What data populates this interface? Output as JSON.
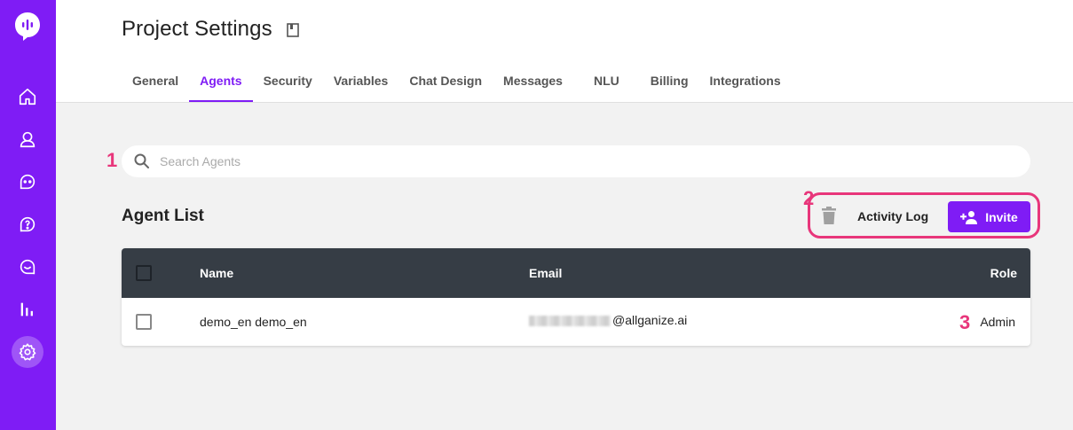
{
  "header": {
    "title": "Project Settings",
    "tabs": [
      {
        "label": "General"
      },
      {
        "label": "Agents"
      },
      {
        "label": "Security"
      },
      {
        "label": "Variables"
      },
      {
        "label": "Chat Design"
      },
      {
        "label": "Messages"
      },
      {
        "label": "NLU"
      },
      {
        "label": "Billing"
      },
      {
        "label": "Integrations"
      }
    ],
    "active_tab": "Agents"
  },
  "sidebar": {
    "icons": [
      "logo-icon",
      "home-icon",
      "user-icon",
      "chat-icon",
      "help-icon",
      "conversation-icon",
      "analytics-icon",
      "settings-icon"
    ],
    "active": "settings-icon"
  },
  "search": {
    "placeholder": "Search Agents",
    "value": ""
  },
  "agent_list": {
    "title": "Agent List",
    "activity_log_label": "Activity Log",
    "invite_label": "Invite",
    "columns": {
      "name": "Name",
      "email": "Email",
      "role": "Role"
    },
    "rows": [
      {
        "name": "demo_en demo_en",
        "email": "@allganize.ai",
        "role": "Admin"
      }
    ]
  },
  "markers": {
    "one": "1",
    "two": "2",
    "three": "3"
  },
  "colors": {
    "brand": "#7f1cf5",
    "marker": "#e8367b",
    "table_header": "#363d45"
  }
}
